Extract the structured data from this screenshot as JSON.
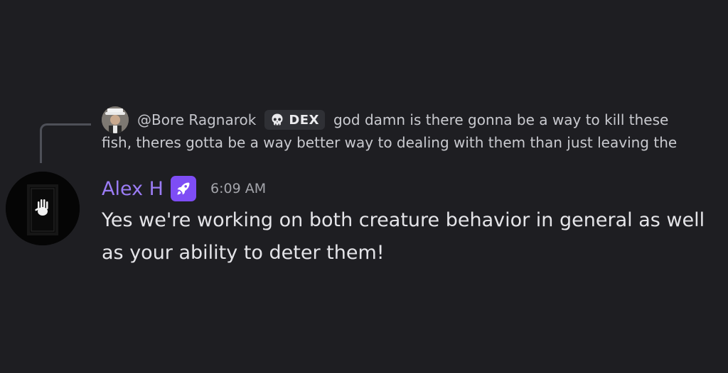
{
  "reply": {
    "author": "@Bore Ragnarok",
    "guild_tag": "DEX",
    "guild_tag_icon": "skull-icon",
    "text_line1": "god damn is there gonna be a way to kill these",
    "text_line2": "fish, theres gotta be a way better way to dealing with them than just leaving the"
  },
  "message": {
    "author": "Alex H",
    "author_color": "#9b7cf5",
    "role_icon": "rocket-icon",
    "role_icon_color": "#7e4df5",
    "timestamp": "6:09 AM",
    "content": "Yes we're working on both creature behavior in general as well as your ability to deter them!"
  },
  "colors": {
    "background": "#1e1e22",
    "reply_spine": "#4e5058",
    "guild_tag_bg": "#2f3035"
  }
}
